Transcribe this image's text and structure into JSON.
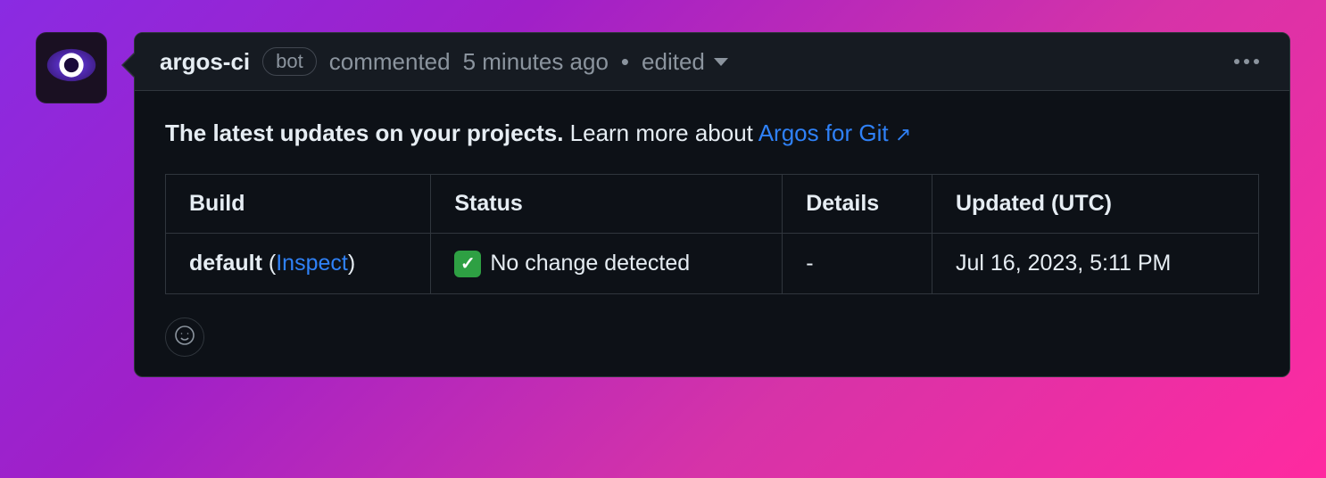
{
  "header": {
    "author": "argos-ci",
    "badge": "bot",
    "action": "commented",
    "time": "5 minutes ago",
    "edited": "edited"
  },
  "body": {
    "lead_strong": "The latest updates on your projects.",
    "lead_rest": " Learn more about ",
    "link_text": "Argos for Git",
    "link_arrow": "↗"
  },
  "table": {
    "headers": {
      "build": "Build",
      "status": "Status",
      "details": "Details",
      "updated": "Updated (UTC)"
    },
    "row": {
      "build_name": "default",
      "inspect_open": " (",
      "inspect_link": "Inspect",
      "inspect_close": ")",
      "check_glyph": "✓",
      "status_text": "No change detected",
      "details": "-",
      "updated": "Jul 16, 2023, 5:11 PM"
    }
  },
  "icons": {
    "avatar": "argos-eye-icon",
    "reaction": "smiley-icon",
    "kebab": "kebab-icon",
    "caret": "caret-down-icon"
  },
  "colors": {
    "link": "#2f81f7",
    "border": "#30363d",
    "bg": "#0d1117",
    "header_bg": "#161b22",
    "muted": "#8b949e",
    "status_green": "#2ea043"
  }
}
